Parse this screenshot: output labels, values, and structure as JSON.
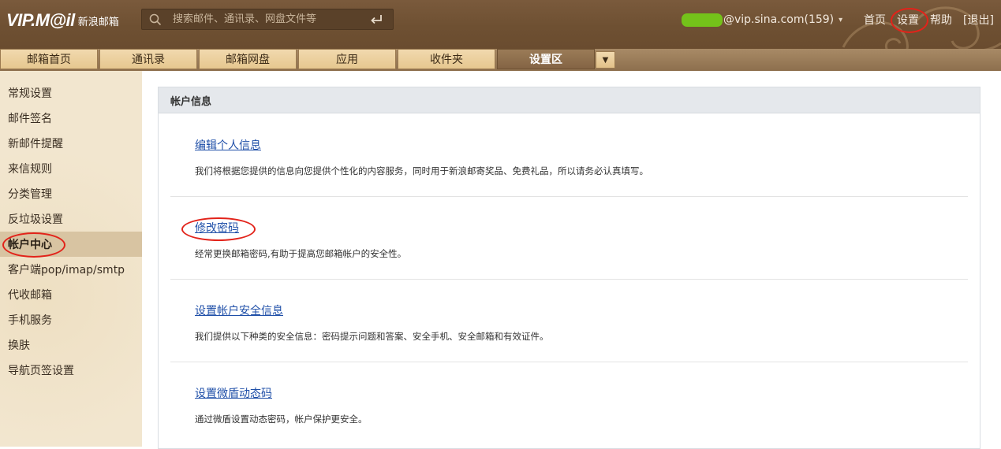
{
  "header": {
    "logo_main": "VIP.M@il",
    "logo_sub": "新浪邮箱",
    "search_placeholder": "搜索邮件、通讯录、网盘文件等",
    "account_text": "@vip.sina.com(159)",
    "links": [
      "首页",
      "设置",
      "帮助",
      "[退出]"
    ]
  },
  "tabs": [
    "邮箱首页",
    "通讯录",
    "邮箱网盘",
    "应用",
    "收件夹",
    "设置区"
  ],
  "active_tab": "设置区",
  "sidebar": {
    "items": [
      "常规设置",
      "邮件签名",
      "新邮件提醒",
      "来信规则",
      "分类管理",
      "反垃圾设置",
      "帐户中心",
      "客户端pop/imap/smtp",
      "代收邮箱",
      "手机服务",
      "换肤",
      "导航页签设置"
    ],
    "active": "帐户中心"
  },
  "panel": {
    "title": "帐户信息",
    "sections": [
      {
        "link": "编辑个人信息",
        "desc": "我们将根据您提供的信息向您提供个性化的内容服务，同时用于新浪邮寄奖品、免费礼品，所以请务必认真填写。"
      },
      {
        "link": "修改密码",
        "desc": "经常更换邮箱密码,有助于提高您邮箱帐户的安全性。"
      },
      {
        "link": "设置帐户安全信息",
        "desc": "我们提供以下种类的安全信息：密码提示问题和答案、安全手机、安全邮箱和有效证件。"
      },
      {
        "link": "设置微盾动态码",
        "desc": "通过微盾设置动态密码，帐户保护更安全。"
      }
    ]
  },
  "colors": {
    "header_bg": "#6e5032",
    "tab_bg": "#e6c78f",
    "tab_active_bg": "#846444",
    "sidebar_bg": "#f2e6cf",
    "sidebar_active_bg": "#d8c4a2",
    "link": "#1f4fa8",
    "annotation_circle": "#e2231a"
  }
}
